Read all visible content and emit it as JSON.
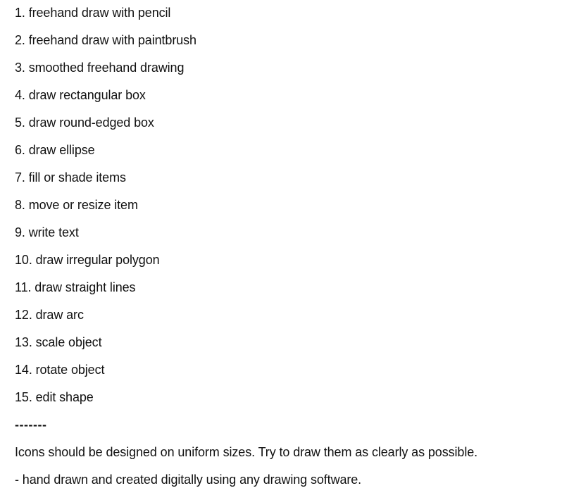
{
  "document": {
    "list_items": [
      "1. freehand draw with pencil",
      "2. freehand draw with paintbrush",
      "3. smoothed freehand drawing",
      "4. draw rectangular box",
      "5. draw round-edged box",
      "6. draw ellipse",
      "7. fill or shade items",
      "8. move or resize item",
      "9. write text",
      "10. draw irregular polygon",
      "11. draw straight lines",
      "12. draw arc",
      "13. scale object",
      "14. rotate object",
      "15. edit shape"
    ],
    "separator": "-------",
    "notes": [
      "Icons should be designed on uniform sizes. Try to draw them as clearly as possible.",
      "- hand drawn and created digitally using any drawing software."
    ]
  }
}
